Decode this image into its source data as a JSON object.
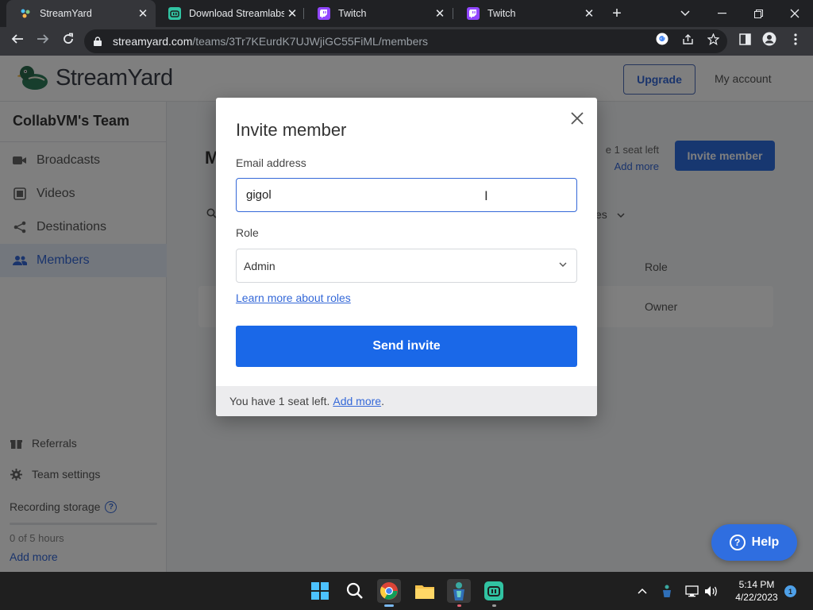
{
  "browser": {
    "tabs": [
      {
        "title": "StreamYard",
        "active": true,
        "favicon": "streamyard-favicon"
      },
      {
        "title": "Download Streamlabs D",
        "active": false,
        "favicon": "streamlabs-favicon"
      },
      {
        "title": "Twitch",
        "active": false,
        "favicon": "twitch-favicon"
      },
      {
        "title": "Twitch",
        "active": false,
        "favicon": "twitch-favicon"
      }
    ],
    "url_domain": "streamyard.com",
    "url_path": "/teams/3Tr7KEurdK7UJWjiGC55FiML/members"
  },
  "header": {
    "logo_text": "StreamYard",
    "upgrade_label": "Upgrade",
    "account_label": "My account"
  },
  "sidebar": {
    "team_name": "CollabVM's Team",
    "items": [
      {
        "label": "Broadcasts",
        "icon": "camera-icon"
      },
      {
        "label": "Videos",
        "icon": "film-icon"
      },
      {
        "label": "Destinations",
        "icon": "share-icon"
      },
      {
        "label": "Members",
        "icon": "people-icon",
        "active": true
      }
    ],
    "footer_items": [
      {
        "label": "Referrals",
        "icon": "gift-icon"
      },
      {
        "label": "Team settings",
        "icon": "gear-icon"
      }
    ],
    "storage_label": "Recording storage",
    "storage_value": "0 of 5 hours",
    "storage_add": "Add more"
  },
  "main": {
    "title_partial": "M",
    "seat_text": "e 1 seat left",
    "add_more": "Add more",
    "invite_label": "Invite member",
    "filter_partial": "es",
    "role_column": "Role",
    "owner_value": "Owner"
  },
  "modal": {
    "title": "Invite member",
    "email_label": "Email address",
    "email_value": "gigol",
    "role_label": "Role",
    "role_value": "Admin",
    "learn_link": "Learn more about roles",
    "send_label": "Send invite",
    "footer_text": "You have 1 seat left.",
    "footer_link": "Add more",
    "footer_period": "."
  },
  "help": {
    "label": "Help"
  },
  "taskbar": {
    "time": "5:14 PM",
    "date": "4/22/2023",
    "notification_count": "1"
  },
  "colors": {
    "accent": "#1a68e8",
    "chrome_dark": "#202124",
    "chrome_toolbar": "#35363a",
    "taskbar": "#1f1f1f"
  }
}
